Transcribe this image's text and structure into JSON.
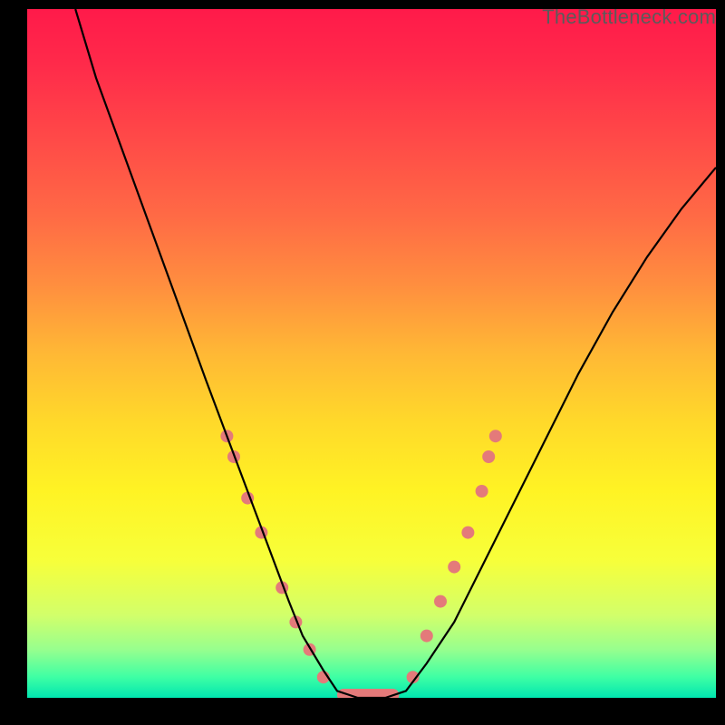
{
  "watermark": "TheBottleneck.com",
  "chart_data": {
    "type": "line",
    "title": "",
    "xlabel": "",
    "ylabel": "",
    "xlim": [
      0,
      100
    ],
    "ylim": [
      0,
      100
    ],
    "grid": false,
    "legend": false,
    "note": "Values estimated from pixel positions; axes unlabeled in source image.",
    "series": [
      {
        "name": "bottleneck-curve",
        "color": "#000000",
        "x": [
          7,
          10,
          14,
          18,
          22,
          26,
          29,
          32,
          35,
          38,
          40,
          43,
          45,
          48,
          52,
          55,
          58,
          62,
          66,
          70,
          75,
          80,
          85,
          90,
          95,
          100
        ],
        "y": [
          100,
          90,
          79,
          68,
          57,
          46,
          38,
          30,
          22,
          14,
          9,
          4,
          1,
          0,
          0,
          1,
          5,
          11,
          19,
          27,
          37,
          47,
          56,
          64,
          71,
          77
        ]
      }
    ],
    "markers": [
      {
        "name": "left-cluster",
        "color": "#e47a7a",
        "shape": "circle",
        "r": 7,
        "points": [
          {
            "x": 29,
            "y": 38
          },
          {
            "x": 30,
            "y": 35
          },
          {
            "x": 32,
            "y": 29
          },
          {
            "x": 34,
            "y": 24
          },
          {
            "x": 37,
            "y": 16
          },
          {
            "x": 39,
            "y": 11
          },
          {
            "x": 41,
            "y": 7
          },
          {
            "x": 43,
            "y": 3
          }
        ]
      },
      {
        "name": "bottom-flat",
        "color": "#e47a7a",
        "shape": "rounded-bar",
        "points": [
          {
            "x_start": 45,
            "x_end": 54,
            "y": 0
          }
        ]
      },
      {
        "name": "right-cluster",
        "color": "#e47a7a",
        "shape": "circle",
        "r": 7,
        "points": [
          {
            "x": 56,
            "y": 3
          },
          {
            "x": 58,
            "y": 9
          },
          {
            "x": 60,
            "y": 14
          },
          {
            "x": 62,
            "y": 19
          },
          {
            "x": 64,
            "y": 24
          },
          {
            "x": 66,
            "y": 30
          },
          {
            "x": 67,
            "y": 35
          },
          {
            "x": 68,
            "y": 38
          }
        ]
      }
    ]
  }
}
